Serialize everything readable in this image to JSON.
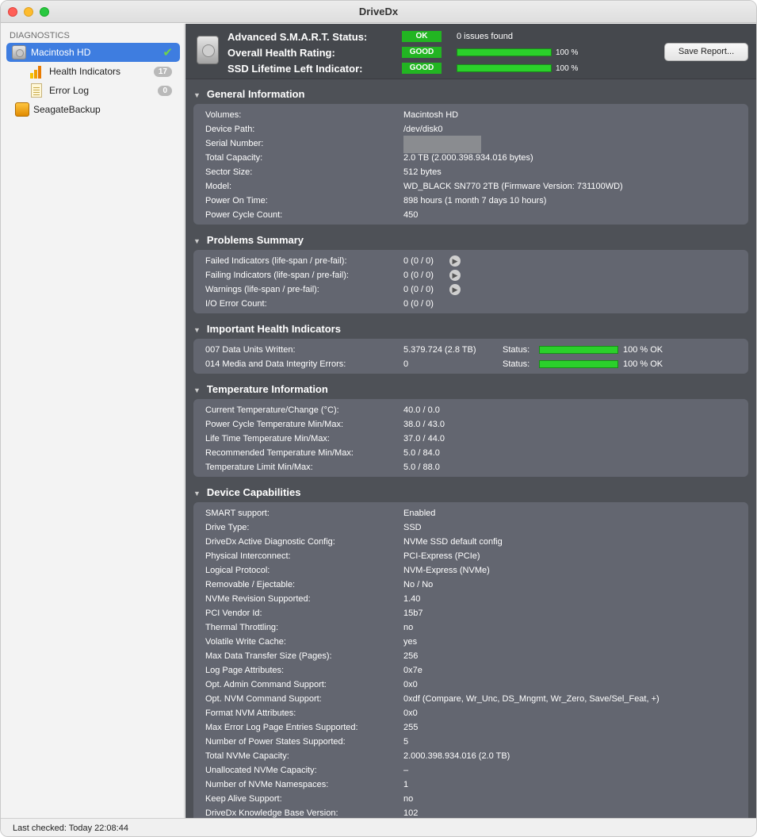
{
  "window": {
    "title": "DriveDx"
  },
  "sidebar": {
    "header": "DIAGNOSTICS",
    "items": [
      {
        "label": "Macintosh HD",
        "icon": "hard-drive-icon"
      },
      {
        "label": "Health Indicators",
        "count": "17",
        "icon": "bar-chart-icon"
      },
      {
        "label": "Error Log",
        "count": "0",
        "icon": "log-document-icon"
      },
      {
        "label": "SeagateBackup",
        "icon": "external-drive-icon"
      }
    ]
  },
  "summary": {
    "smart_label": "Advanced S.M.A.R.T. Status:",
    "smart_status": "OK",
    "smart_text": "0 issues found",
    "health_label": "Overall Health Rating:",
    "health_status": "GOOD",
    "health_pct": "100 %",
    "health_fraction": 1.0,
    "ssd_label": "SSD Lifetime Left Indicator:",
    "ssd_status": "GOOD",
    "ssd_pct": "100 %",
    "ssd_fraction": 1.0,
    "save_button": "Save Report...",
    "ok_color": "#22b522"
  },
  "general": {
    "title": "General Information",
    "rows": [
      {
        "label": "Volumes:",
        "value": "Macintosh HD"
      },
      {
        "label": "Device Path:",
        "value": "/dev/disk0"
      },
      {
        "label": "Serial Number:",
        "value": ""
      },
      {
        "label": "Total Capacity:",
        "value": "2.0 TB (2.000.398.934.016 bytes)"
      },
      {
        "label": "Sector Size:",
        "value": "512 bytes"
      },
      {
        "label": "Model:",
        "value": "WD_BLACK SN770 2TB  (Firmware Version: 731100WD)"
      },
      {
        "label": "Power On Time:",
        "value": "898 hours (1 month 7 days 10 hours)"
      },
      {
        "label": "Power Cycle Count:",
        "value": "450"
      }
    ]
  },
  "problems": {
    "title": "Problems Summary",
    "rows": [
      {
        "label": "Failed Indicators (life-span / pre-fail):",
        "value": "0 (0 / 0)"
      },
      {
        "label": "Failing Indicators (life-span / pre-fail):",
        "value": "0 (0 / 0)"
      },
      {
        "label": "Warnings (life-span / pre-fail):",
        "value": "0 (0 / 0)"
      },
      {
        "label": "I/O Error Count:",
        "value": "0 (0 / 0)"
      }
    ]
  },
  "health": {
    "title": "Important Health Indicators",
    "status_label": "Status:",
    "rows": [
      {
        "label": "007  Data Units Written:",
        "value": "5.379.724 (2.8 TB)",
        "pct": "100 %  OK",
        "fraction": 1.0
      },
      {
        "label": "014  Media and Data Integrity Errors:",
        "value": "0",
        "pct": "100 %  OK",
        "fraction": 1.0
      }
    ]
  },
  "temperature": {
    "title": "Temperature Information",
    "rows": [
      {
        "label": "Current Temperature/Change (°C):",
        "value": "40.0 / 0.0"
      },
      {
        "label": "Power Cycle Temperature Min/Max:",
        "value": "38.0 / 43.0"
      },
      {
        "label": "Life Time Temperature Min/Max:",
        "value": "37.0 / 44.0"
      },
      {
        "label": "Recommended Temperature Min/Max:",
        "value": "5.0   / 84.0"
      },
      {
        "label": "Temperature Limit Min/Max:",
        "value": "5.0   / 88.0"
      }
    ]
  },
  "capabilities": {
    "title": "Device Capabilities",
    "rows": [
      {
        "label": "SMART support:",
        "value": "Enabled"
      },
      {
        "label": "Drive Type:",
        "value": "SSD"
      },
      {
        "label": "DriveDx Active Diagnostic Config:",
        "value": "NVMe SSD default config"
      },
      {
        "label": "Physical Interconnect:",
        "value": "PCI-Express (PCIe)"
      },
      {
        "label": "Logical Protocol:",
        "value": "NVM-Express (NVMe)"
      },
      {
        "label": "Removable / Ejectable:",
        "value": "No / No"
      },
      {
        "label": "NVMe Revision Supported:",
        "value": "1.40"
      },
      {
        "label": "PCI Vendor Id:",
        "value": "15b7"
      },
      {
        "label": "Thermal Throttling:",
        "value": "no"
      },
      {
        "label": "Volatile Write Cache:",
        "value": "yes"
      },
      {
        "label": "Max Data Transfer Size (Pages):",
        "value": "256"
      },
      {
        "label": "Log Page Attributes:",
        "value": "0x7e"
      },
      {
        "label": "Opt. Admin Command Support:",
        "value": "0x0"
      },
      {
        "label": "Opt. NVM Command Support:",
        "value": "0xdf (Compare, Wr_Unc, DS_Mngmt, Wr_Zero, Save/Sel_Feat, +)"
      },
      {
        "label": "Format NVM Attributes:",
        "value": "0x0"
      },
      {
        "label": "Max Error Log Page Entries Supported:",
        "value": "255"
      },
      {
        "label": "Number of Power States Supported:",
        "value": "5"
      },
      {
        "label": "Total NVMe Capacity:",
        "value": "2.000.398.934.016 (2.0 TB)"
      },
      {
        "label": "Unallocated NVMe Capacity:",
        "value": "–"
      },
      {
        "label": "Number of NVMe Namespaces:",
        "value": "1"
      },
      {
        "label": "Keep Alive Support:",
        "value": "no"
      },
      {
        "label": "DriveDx Knowledge Base Version:",
        "value": "102"
      }
    ]
  },
  "statusbar": {
    "text": "Last checked: Today 22:08:44"
  }
}
